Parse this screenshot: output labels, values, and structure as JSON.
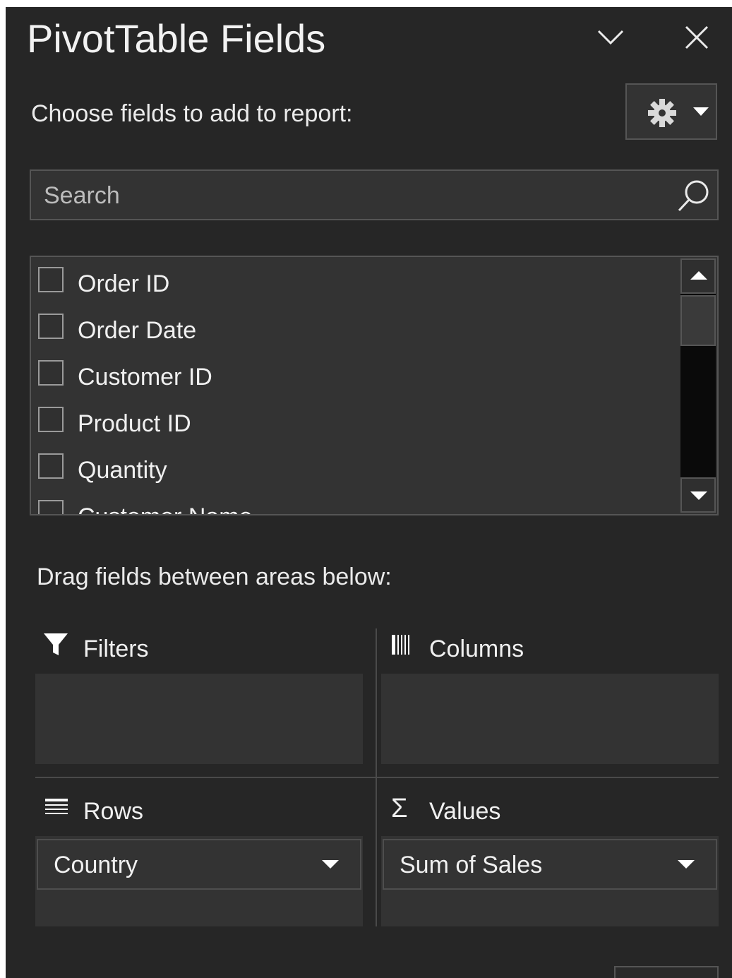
{
  "header": {
    "title": "PivotTable Fields",
    "collapse_icon": "chevron-down-icon",
    "close_icon": "close-icon"
  },
  "chooser": {
    "label": "Choose fields to add to report:",
    "settings_icon": "gear-icon"
  },
  "search": {
    "placeholder": "Search",
    "icon": "search-icon"
  },
  "fields": [
    {
      "label": "Order ID",
      "checked": false
    },
    {
      "label": "Order Date",
      "checked": false
    },
    {
      "label": "Customer ID",
      "checked": false
    },
    {
      "label": "Product ID",
      "checked": false
    },
    {
      "label": "Quantity",
      "checked": false
    },
    {
      "label": "Customer Name",
      "checked": false
    }
  ],
  "areas": {
    "instruction": "Drag fields between areas below:",
    "filters": {
      "label": "Filters",
      "icon": "filter-icon",
      "items": []
    },
    "columns": {
      "label": "Columns",
      "icon": "columns-icon",
      "items": []
    },
    "rows": {
      "label": "Rows",
      "icon": "rows-icon",
      "items": [
        {
          "label": "Country"
        }
      ]
    },
    "values": {
      "label": "Values",
      "icon": "sigma-icon",
      "items": [
        {
          "label": "Sum of Sales"
        }
      ]
    }
  },
  "colors": {
    "pane_bg": "#262626",
    "box_bg": "#333333",
    "border": "#555555",
    "text": "#f0f0f0"
  }
}
